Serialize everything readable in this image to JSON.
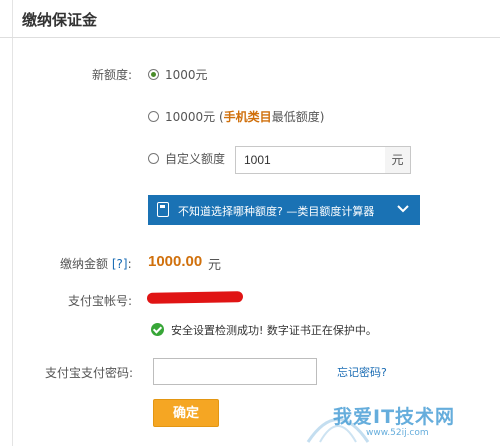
{
  "header": {
    "title": "缴纳保证金"
  },
  "form": {
    "new_quota_label": "新额度:",
    "options": [
      {
        "label": "1000元",
        "selected": true
      },
      {
        "label_prefix": "10000元 (",
        "highlight": "手机类目",
        "label_suffix": "最低额度)",
        "selected": false
      },
      {
        "label": "自定义额度",
        "selected": false
      }
    ],
    "custom_value": "1001",
    "custom_unit": "元",
    "calculator_text": "不知道选择哪种额度? —类目额度计算器",
    "pay_amount_label": "缴纳金额",
    "help_link": "[?]",
    "pay_amount_colon": ":",
    "pay_amount_value": "1000.00",
    "pay_amount_unit": "元",
    "alipay_account_label": "支付宝帐号:",
    "security_message": "安全设置检测成功! 数字证书正在保护中。",
    "alipay_password_label": "支付宝支付密码:",
    "password_value": "",
    "forgot_password": "忘记密码?",
    "confirm_button": "确定"
  },
  "watermark": {
    "text": "我爱IT技术网",
    "url": "www.52ij.com"
  },
  "colors": {
    "accent_orange": "#d0700c",
    "link_blue": "#1a6cb4",
    "calc_bar": "#1a72b4",
    "button": "#f5a623",
    "success": "#37a637",
    "redaction": "#e01414"
  }
}
